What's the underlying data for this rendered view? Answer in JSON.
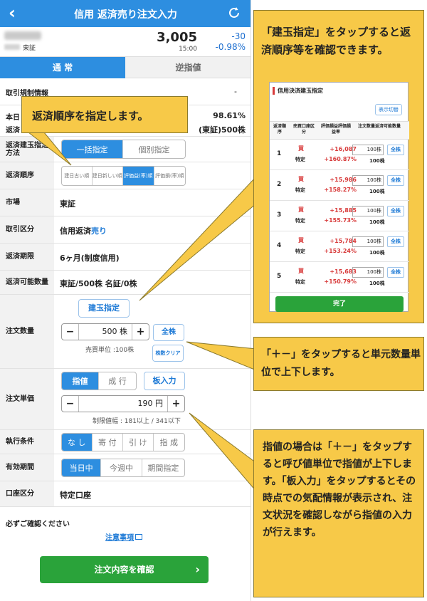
{
  "header": {
    "back_icon": "chevron-left-icon",
    "title": "信用 返済売り注文入力",
    "refresh_icon": "refresh-icon"
  },
  "stock": {
    "market": "東証",
    "price": "3,005",
    "time": "15:00",
    "change": "-30",
    "change_pct": "-0.98%"
  },
  "tabs": {
    "normal": "通 常",
    "stop": "逆指値"
  },
  "rows": {
    "hidden_label_1": "取引規制情報",
    "hidden_value_1": "-",
    "hidden_label_2": "本日",
    "hidden_label_3": "返済",
    "hidden_value_2": "98.61%",
    "hidden_value_3": "(東証)500株",
    "method_label": "返済建玉指定方法",
    "method_options": [
      "一括指定",
      "個別指定"
    ],
    "order_label": "返済順序",
    "order_options": [
      "建日古い順",
      "建日新しい順",
      "評価益(率)順",
      "評価損(率)順"
    ],
    "market_label": "市場",
    "market_value": "東証",
    "trade_label": "取引区分",
    "trade_value_prefix": "信用返済",
    "trade_value_suffix": "売り",
    "deadline_label": "返済期限",
    "deadline_value": "6ヶ月(制度信用)",
    "avail_label": "返済可能数量",
    "avail_value": "東証/500株 名証/0株",
    "qty_label": "注文数量",
    "position_btn": "建玉指定",
    "qty_value": "500 株",
    "qty_all": "全株",
    "qty_unit_note": "売買単位 :100株",
    "qty_clear": "株数クリア",
    "price_label": "注文単価",
    "price_types": [
      "指値",
      "成 行"
    ],
    "board_btn": "板入力",
    "price_value": "190 円",
    "price_limit": "制限値幅 : 181以上 / 341以下",
    "exec_label": "執行条件",
    "exec_options": [
      "な し",
      "寄 付",
      "引 け",
      "指 成"
    ],
    "period_label": "有効期間",
    "period_options": [
      "当日中",
      "今週中",
      "期間指定"
    ],
    "account_label": "口座区分",
    "account_value": "特定口座"
  },
  "confirm": {
    "must_check": "必ずご確認ください",
    "caution_link": "注意事項",
    "button": "注文内容を確認"
  },
  "callouts": {
    "c1": "返済順序を指定します。",
    "c2": "「建玉指定」をタップすると返済順序等を確認できます。",
    "c3": "「＋－」をタップすると単元数量単位で上下します。",
    "c4": "指値の場合は「＋－」をタップすると呼び値単位で指値が上下します。「板入力」をタップするとその時点での気配情報が表示され、注文状況を確認しながら指値の入力が行えます。"
  },
  "inset": {
    "title": "信用決済建玉指定",
    "switch": "表示切替",
    "head": {
      "order": "返済順序",
      "bs": "売買口座区分",
      "pl": "評価損益評価損益率",
      "qty": "注文数量返済可能数量"
    },
    "rows": [
      {
        "no": "1",
        "bs": "買",
        "acct": "特定",
        "pl": "+16,087",
        "pct": "+160.87%",
        "qty": "100株",
        "avail": "100株",
        "all": "全株"
      },
      {
        "no": "2",
        "bs": "買",
        "acct": "特定",
        "pl": "+15,986",
        "pct": "+158.27%",
        "qty": "100株",
        "avail": "100株",
        "all": "全株"
      },
      {
        "no": "3",
        "bs": "買",
        "acct": "特定",
        "pl": "+15,885",
        "pct": "+155.73%",
        "qty": "100株",
        "avail": "100株",
        "all": "全株"
      },
      {
        "no": "4",
        "bs": "買",
        "acct": "特定",
        "pl": "+15,784",
        "pct": "+153.24%",
        "qty": "100株",
        "avail": "100株",
        "all": "全株"
      },
      {
        "no": "5",
        "bs": "買",
        "acct": "特定",
        "pl": "+15,683",
        "pct": "+150.79%",
        "qty": "100株",
        "avail": "100株",
        "all": "全株"
      }
    ],
    "done": "完了"
  },
  "colors": {
    "primary": "#2d8ee0",
    "callout": "#f7c948",
    "confirm": "#2aa33a",
    "profit": "#d83b3b"
  }
}
